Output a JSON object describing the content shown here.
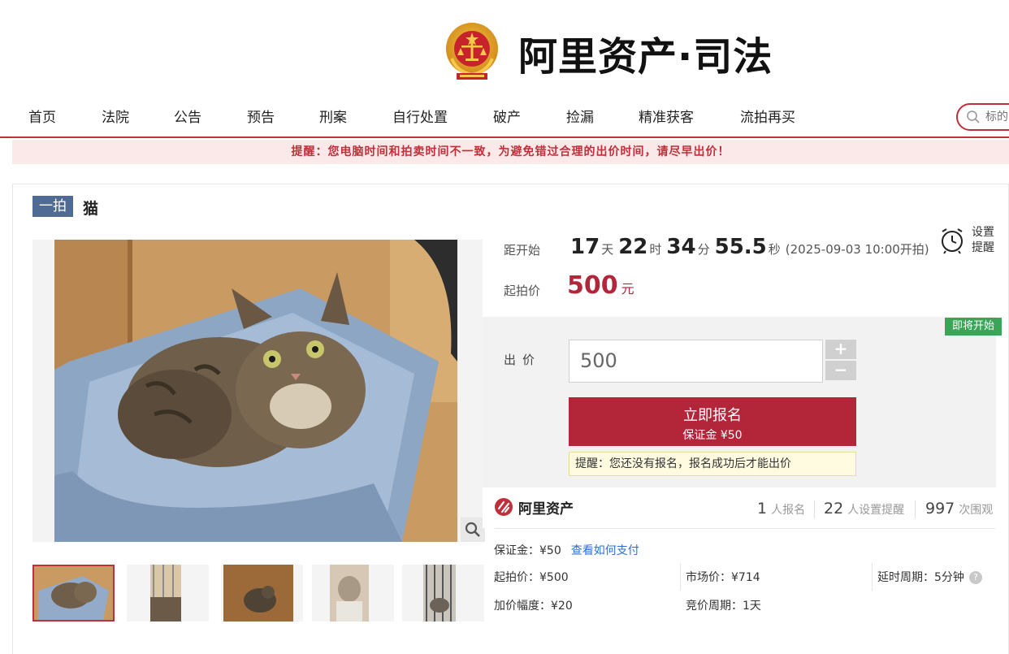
{
  "brand": {
    "title": "阿里资产·司法"
  },
  "nav": {
    "items": [
      "首页",
      "法院",
      "公告",
      "预告",
      "刑案",
      "自行处置",
      "破产",
      "捡漏",
      "精准获客",
      "流拍再买"
    ],
    "search_placeholder": "标的"
  },
  "notice": {
    "text": "提醒：您电脑时间和拍卖时间不一致，为避免错过合理的出价时间，请尽早出价！"
  },
  "lot": {
    "tag": "一拍",
    "title": "猫",
    "images": [
      "cat-in-litter-box",
      "cage-1",
      "cat-in-cabinet",
      "cat-held",
      "cat-in-cage"
    ]
  },
  "countdown": {
    "label": "距开始",
    "days": "17",
    "days_unit": "天",
    "hours": "22",
    "hours_unit": "时",
    "minutes": "34",
    "minutes_unit": "分",
    "seconds": "55.5",
    "seconds_unit": "秒",
    "open_time": "(2025-09-03 10:00开拍)"
  },
  "start_price": {
    "label": "起拍价",
    "value": "500",
    "unit": "元"
  },
  "reminder": {
    "label": "设置提醒"
  },
  "status_badge": "即将开始",
  "bid": {
    "label": "出价",
    "value": "500",
    "plus": "+",
    "minus": "−",
    "signup_label": "立即报名",
    "signup_sub": "保证金 ¥50",
    "tip": "提醒：您还没有报名，报名成功后才能出价"
  },
  "stats": {
    "platform": "阿里资产",
    "signups": "1",
    "signups_label": "人报名",
    "reminders": "22",
    "reminders_label": "人设置提醒",
    "views": "997",
    "views_label": "次围观"
  },
  "details": {
    "deposit": "保证金：¥50",
    "pay_link": "查看如何支付",
    "start_price": "起拍价：¥500",
    "market_price": "市场价：¥714",
    "delay_period": "延时周期：5分钟",
    "increment": "加价幅度：¥20",
    "bid_period": "竞价周期：1天"
  },
  "colors": {
    "accent": "#b3263a",
    "nav_border": "#c0303a",
    "badge_green": "#3aa457",
    "tag_blue": "#4f6b93",
    "link": "#2f6fd1"
  }
}
